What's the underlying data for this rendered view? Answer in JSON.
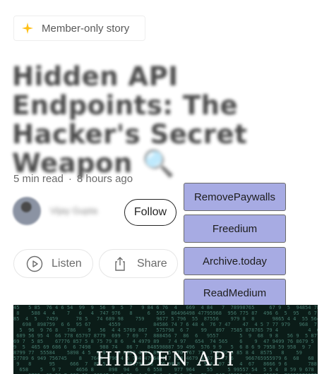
{
  "badge": {
    "label": "Member-only story",
    "icon": "sparkle-icon",
    "icon_color": "#FFC017"
  },
  "article": {
    "title": "Hidden API Endpoints: The Hacker's Secret Weapon 🔍",
    "read_time": "5 min read",
    "separator": "·",
    "posted": "8 hours ago"
  },
  "author": {
    "name": "Vijay Gupta",
    "follow_label": "Follow"
  },
  "actions": {
    "listen_label": "Listen",
    "share_label": "Share"
  },
  "unlock_links": [
    {
      "label": "RemovePaywalls"
    },
    {
      "label": "Freedium"
    },
    {
      "label": "Archive.today"
    },
    {
      "label": "ReadMedium"
    }
  ],
  "hero": {
    "caption": "HIDDEN API"
  },
  "colors": {
    "unlock_bg": "#A7ABE3",
    "text": "#242424",
    "muted": "#6B6B6B"
  }
}
